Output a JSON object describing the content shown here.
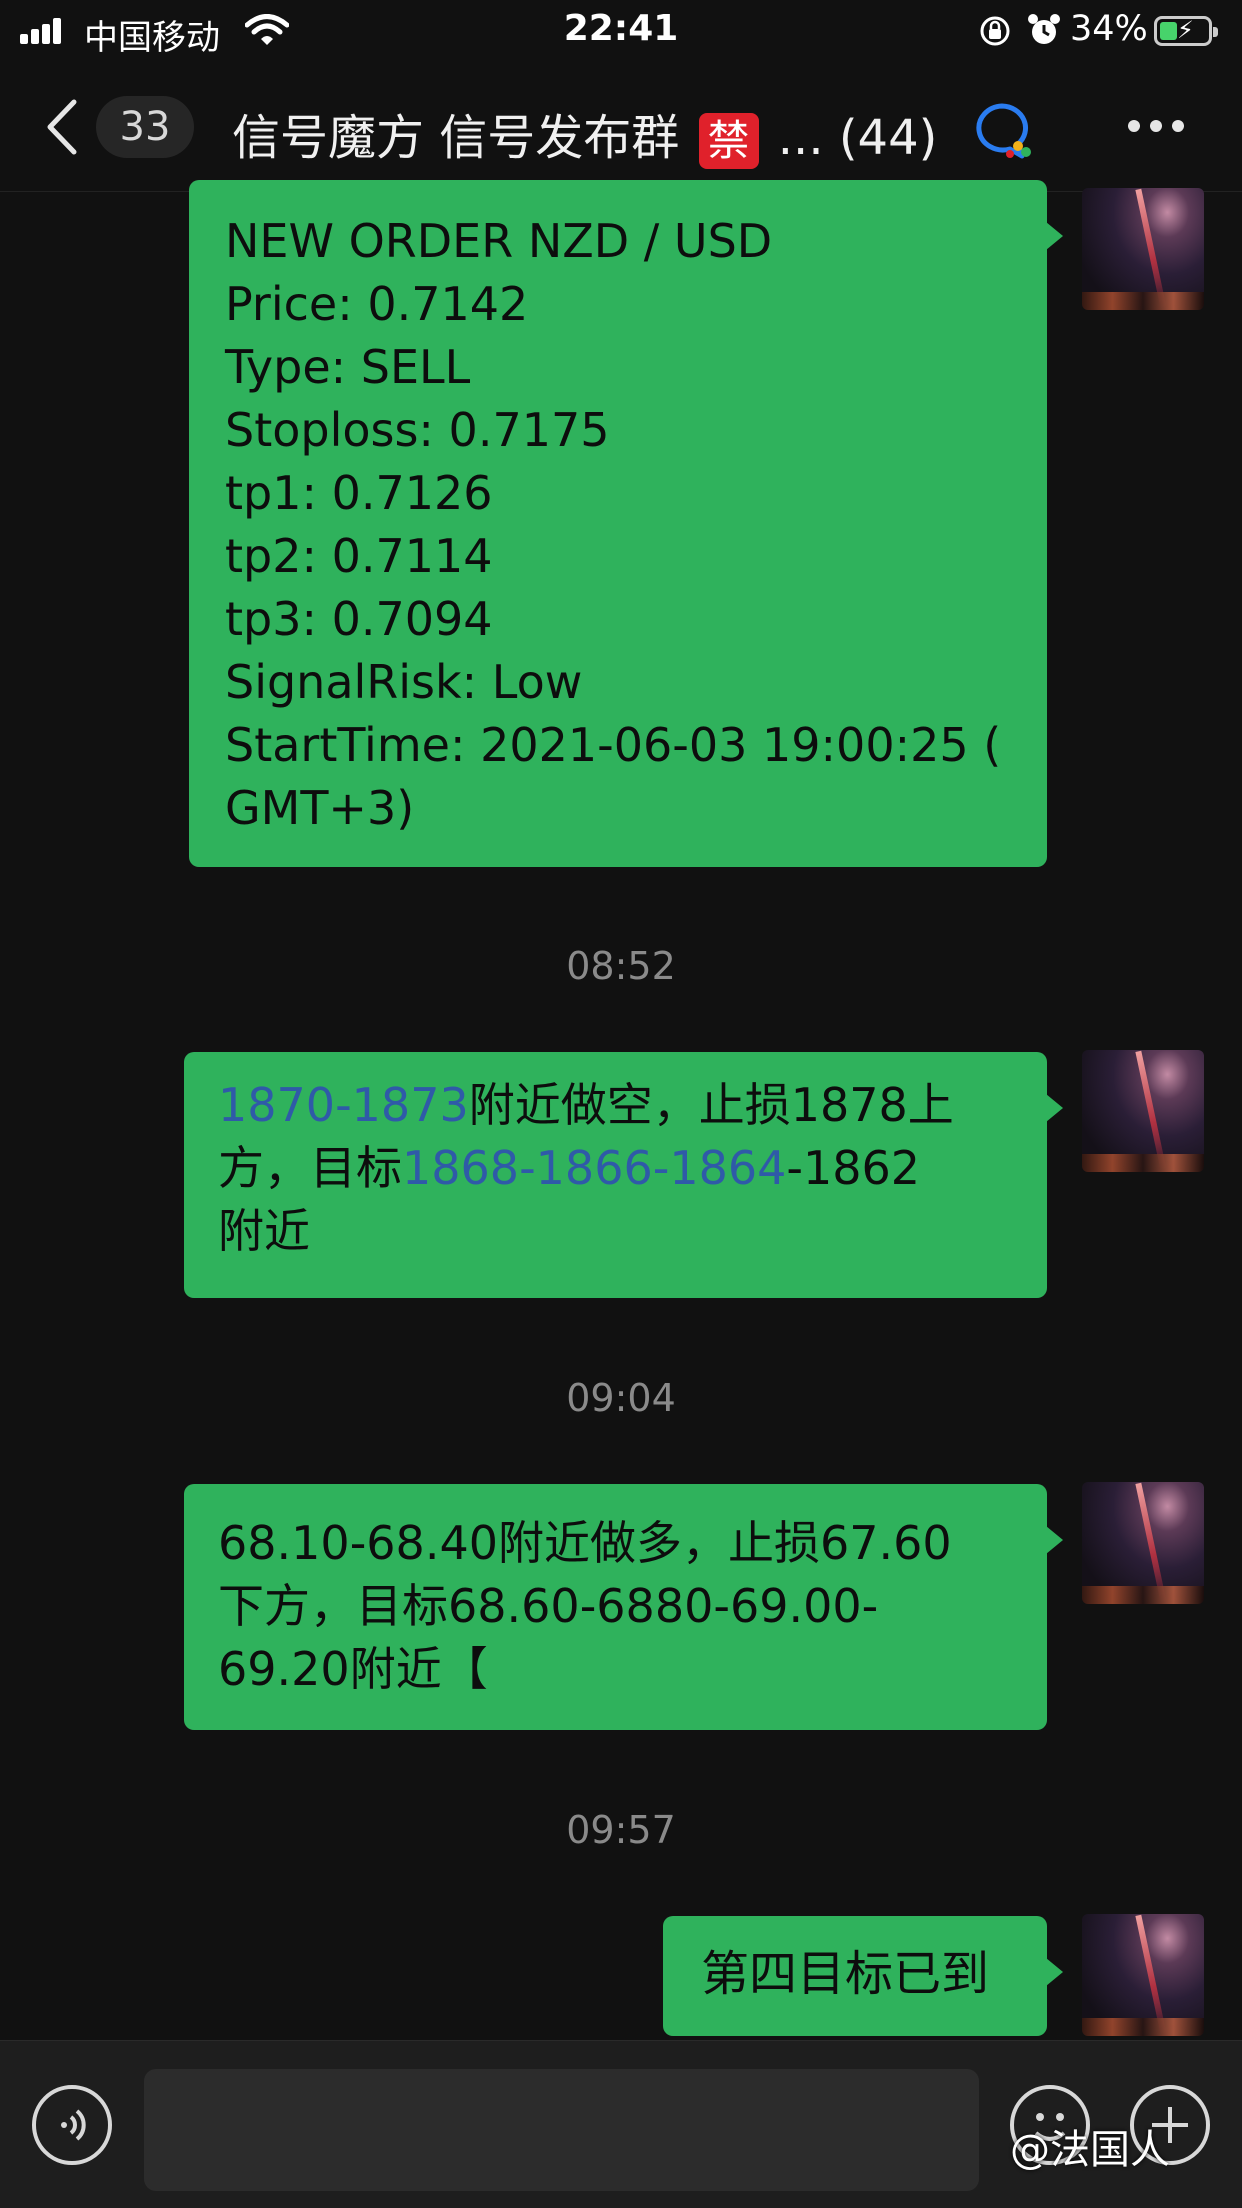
{
  "status_bar": {
    "carrier": "中国移动",
    "time": "22:41",
    "battery_percent": "34%",
    "icons": [
      "signal-icon",
      "wifi-icon",
      "orientation-lock-icon",
      "alarm-icon",
      "battery-charging-icon"
    ]
  },
  "nav": {
    "unread_count": "33",
    "title_before": "信号魔方 信号发布群",
    "ban_emoji": "禁",
    "title_after": "... (44)",
    "icons": [
      "back-chevron-icon",
      "chat-bubble-icon",
      "more-icon"
    ]
  },
  "messages": [
    {
      "lines": [
        "NEW ORDER NZD / USD",
        "Price: 0.7142",
        "Type: SELL",
        "Stoploss: 0.7175",
        "tp1: 0.7126",
        "tp2: 0.7114",
        "tp3: 0.7094",
        "SignalRisk: Low",
        "StartTime: 2021-06-03 19:00:25 (",
        "GMT+3)"
      ]
    },
    {
      "time": "08:52",
      "link1": "1870-1873",
      "text1": "附近做空，止损1878上",
      "text2": "方，目标",
      "link2": "1868-1866-1864",
      "text3": "-1862",
      "text4": "附近"
    },
    {
      "time": "09:04",
      "line1": "68.10-68.40附近做多，止损67.60",
      "line2": "下方，目标68.60-6880-69.00-",
      "line3": "69.20附近【"
    },
    {
      "time": "09:57",
      "text": "第四目标已到"
    }
  ],
  "input_bar": {
    "watermark": "@法国人",
    "icons": [
      "voice-icon",
      "emoji-icon",
      "plus-icon"
    ]
  },
  "colors": {
    "bubble": "#2fb25c",
    "background": "#111111",
    "link": "#2f5aa8",
    "ban_badge": "#e0212b"
  }
}
